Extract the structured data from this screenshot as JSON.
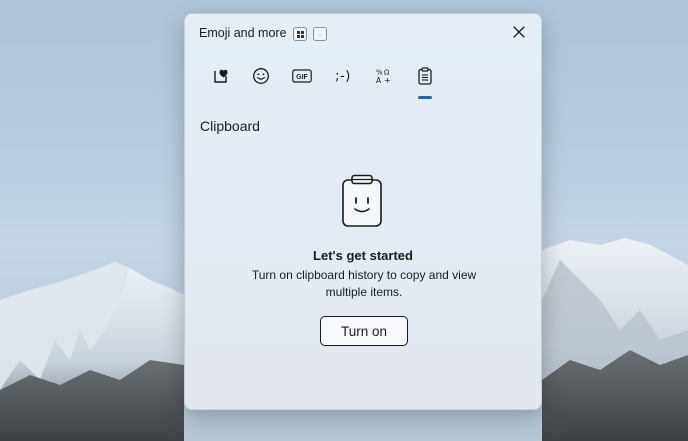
{
  "panel": {
    "title": "Emoji and more",
    "shortcut_keys": [
      "win-key-icon",
      "period-key"
    ],
    "period_key_label": "."
  },
  "tabs": [
    {
      "name": "favorites",
      "icon": "heart-sticker-icon",
      "selected": false
    },
    {
      "name": "emoji",
      "icon": "smiley-icon",
      "selected": false
    },
    {
      "name": "gif",
      "icon": "gif-icon",
      "label": "GIF",
      "selected": false
    },
    {
      "name": "kaomoji",
      "icon": "kaomoji-icon",
      "label": ";-)",
      "selected": false
    },
    {
      "name": "symbols",
      "icon": "symbols-icon",
      "label": "%ΩA+",
      "selected": false
    },
    {
      "name": "clipboard",
      "icon": "clipboard-icon",
      "selected": true
    }
  ],
  "section": {
    "title": "Clipboard"
  },
  "empty_state": {
    "icon": "clipboard-smiley-icon",
    "heading": "Let's get started",
    "description": "Turn on clipboard history to copy and view multiple items.",
    "button_label": "Turn on"
  },
  "colors": {
    "accent": "#0f6cbd",
    "text": "#1b1b1b"
  }
}
